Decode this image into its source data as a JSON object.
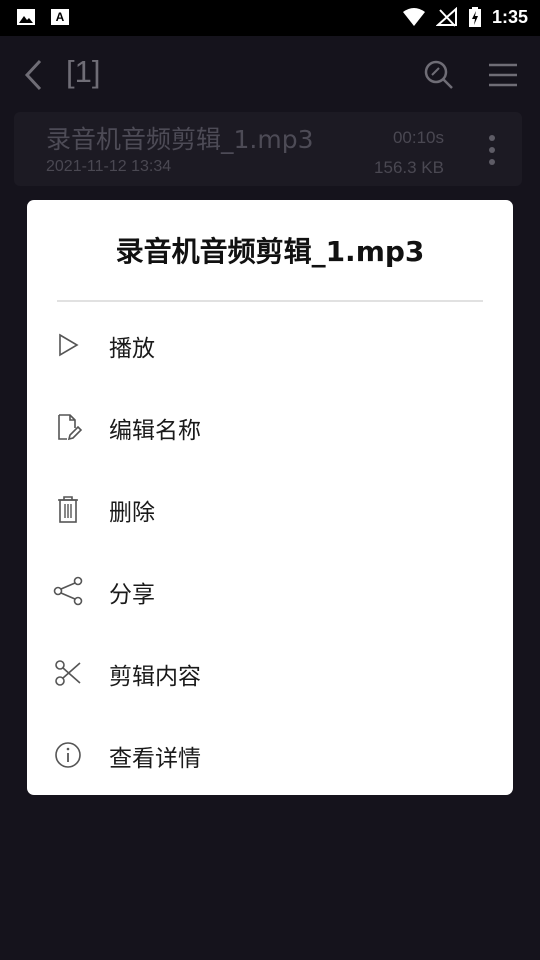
{
  "status_bar": {
    "time": "1:35"
  },
  "app_bar": {
    "title": "[1]"
  },
  "file": {
    "name": "录音机音频剪辑_1.mp3",
    "date": "2021-11-12  13:34",
    "duration": "00:10s",
    "size": "156.3 KB"
  },
  "dialog": {
    "title": "录音机音频剪辑_1.mp3",
    "items": [
      {
        "label": "播放",
        "icon": "play-icon"
      },
      {
        "label": "编辑名称",
        "icon": "edit-file-icon"
      },
      {
        "label": "删除",
        "icon": "trash-icon"
      },
      {
        "label": "分享",
        "icon": "share-icon"
      },
      {
        "label": "剪辑内容",
        "icon": "scissors-icon"
      },
      {
        "label": "查看详情",
        "icon": "info-icon"
      }
    ]
  },
  "colors": {
    "background": "#15131c",
    "dialog": "#ffffff",
    "muted_text": "#4d4b56"
  }
}
